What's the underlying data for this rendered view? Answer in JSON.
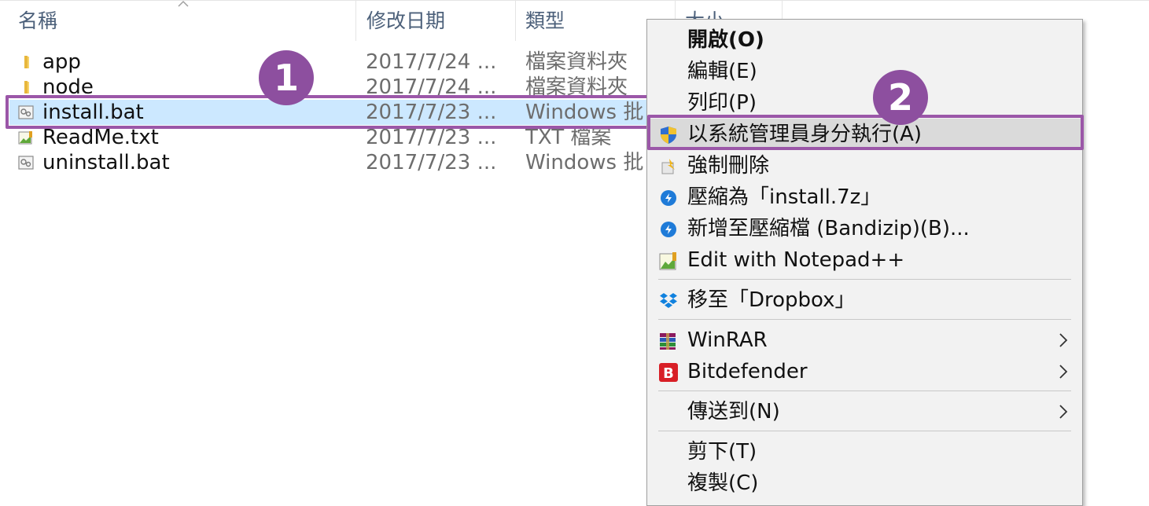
{
  "columns": {
    "name": "名稱",
    "date": "修改日期",
    "type": "類型",
    "size": "大小"
  },
  "files": [
    {
      "name": "app",
      "date": "2017/7/24 ...",
      "type": "檔案資料夾",
      "icon": "folder-icon"
    },
    {
      "name": "node",
      "date": "2017/7/24 ...",
      "type": "檔案資料夾",
      "icon": "folder-icon"
    },
    {
      "name": "install.bat",
      "date": "2017/7/23 ...",
      "type": "Windows 批",
      "icon": "batch-file-icon",
      "selected": true
    },
    {
      "name": "ReadMe.txt",
      "date": "2017/7/23 ...",
      "type": "TXT 檔案",
      "icon": "notepadpp-file-icon"
    },
    {
      "name": "uninstall.bat",
      "date": "2017/7/23 ...",
      "type": "Windows 批",
      "icon": "batch-file-icon"
    }
  ],
  "markers": {
    "one": "1",
    "two": "2"
  },
  "context_menu": {
    "items": [
      {
        "label": "開啟(O)",
        "bold": true
      },
      {
        "label": "編輯(E)"
      },
      {
        "label": "列印(P)"
      },
      {
        "label": "以系統管理員身分執行(A)",
        "icon": "uac-shield-icon",
        "hovered": true
      },
      {
        "label": "強制刪除",
        "icon": "force-delete-icon"
      },
      {
        "label": "壓縮為「install.7z」",
        "icon": "bandizip-icon"
      },
      {
        "label": "新增至壓縮檔 (Bandizip)(B)...",
        "icon": "bandizip-icon"
      },
      {
        "label": "Edit with Notepad++",
        "icon": "notepadpp-icon"
      },
      {
        "label": "移至「Dropbox」",
        "icon": "dropbox-icon"
      },
      {
        "label": "WinRAR",
        "icon": "winrar-icon",
        "submenu": true
      },
      {
        "label": "Bitdefender",
        "icon": "bitdefender-icon",
        "submenu": true
      },
      {
        "label": "傳送到(N)",
        "submenu": true
      },
      {
        "label": "剪下(T)"
      },
      {
        "label": "複製(C)"
      }
    ]
  },
  "colors": {
    "selection": "#cce8ff",
    "annotation": "#9b57a8",
    "menu_background": "#f2f2f2",
    "header_text": "#4c607a"
  }
}
